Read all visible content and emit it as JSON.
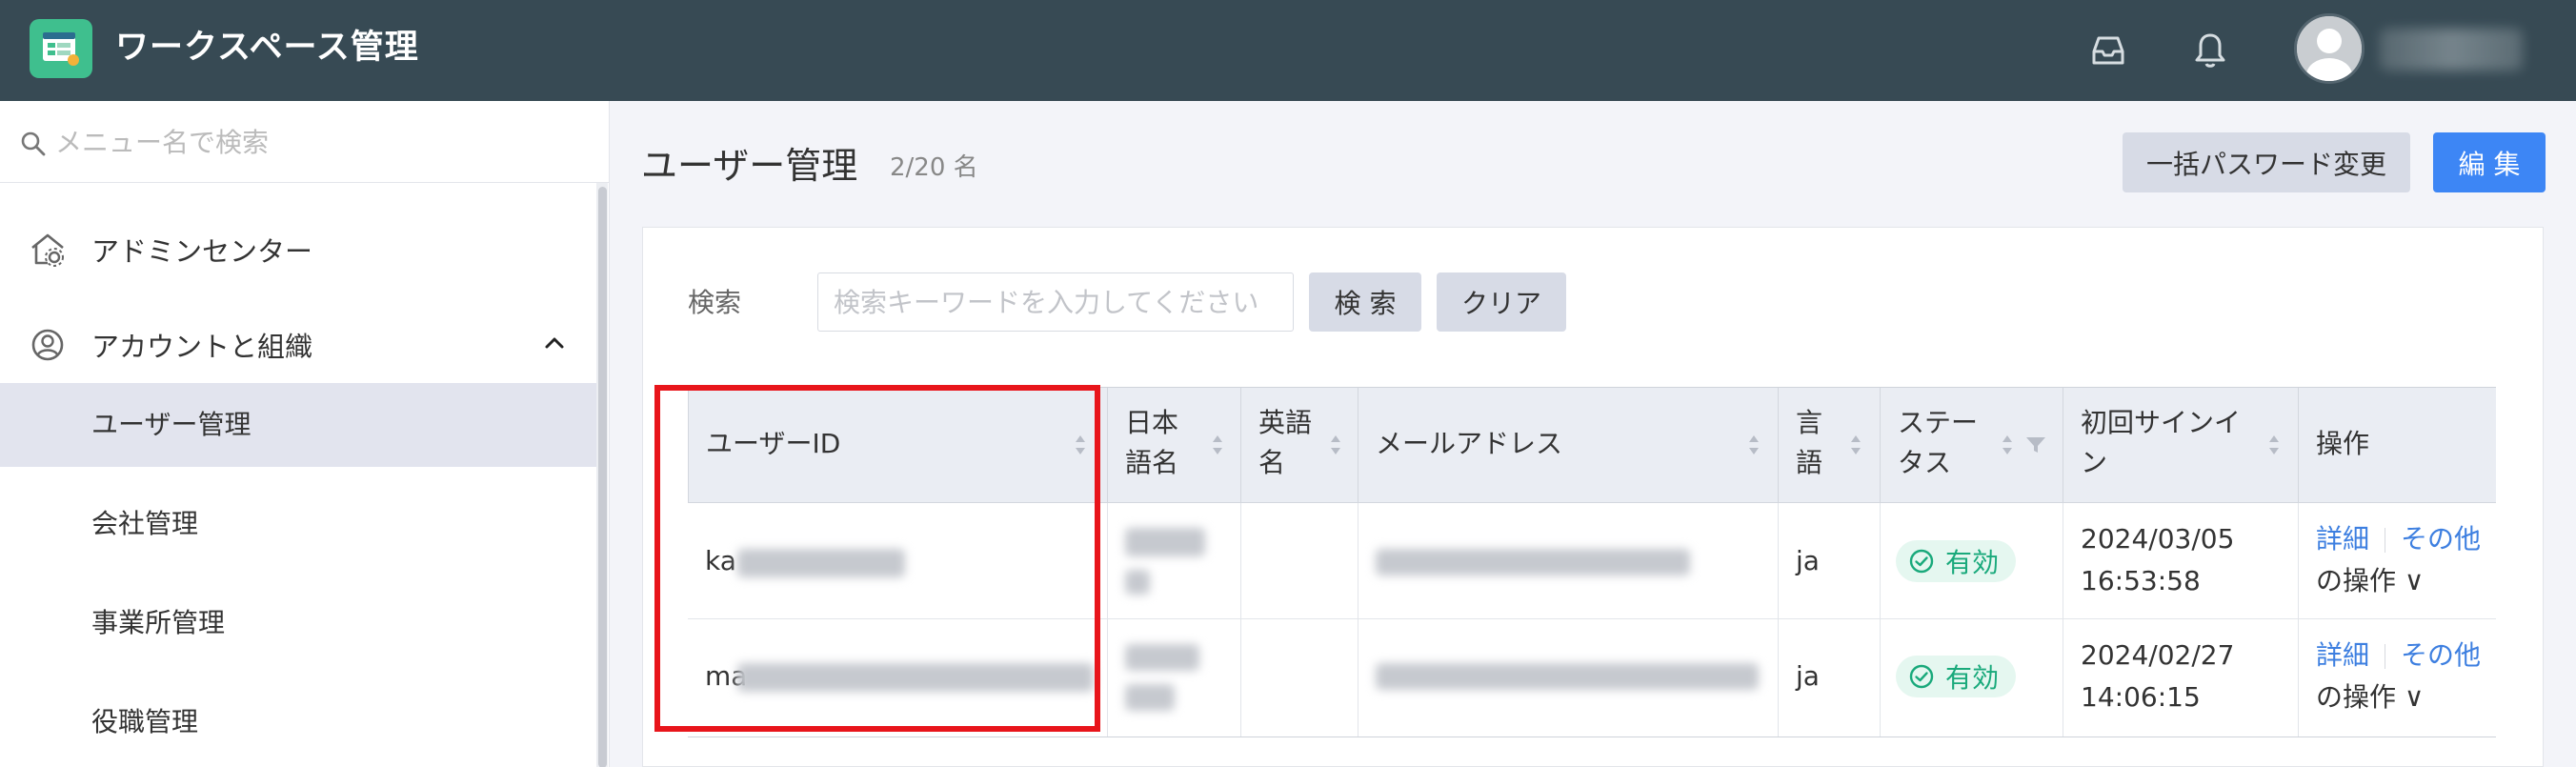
{
  "header": {
    "app_title": "ワークスペース管理",
    "logo_icon": "workspace-logo-icon",
    "inbox_icon": "inbox-icon",
    "bell_icon": "bell-icon",
    "avatar_icon": "user-avatar-icon"
  },
  "sidebar": {
    "search_placeholder": "メニュー名で検索",
    "items": [
      {
        "label": "アドミンセンター",
        "icon": "admin-center-icon"
      },
      {
        "label": "アカウントと組織",
        "icon": "account-icon"
      }
    ],
    "sub_items": [
      {
        "label": "ユーザー管理",
        "active": true
      },
      {
        "label": "会社管理",
        "active": false
      },
      {
        "label": "事業所管理",
        "active": false
      },
      {
        "label": "役職管理",
        "active": false
      }
    ]
  },
  "main": {
    "title": "ユーザー管理",
    "count": "2/20 名",
    "bulk_password_button": "一括パスワード変更",
    "edit_button": "編 集",
    "search_label": "検索",
    "search_placeholder": "検索キーワードを入力してください",
    "search_button": "検 索",
    "clear_button": "クリア"
  },
  "table": {
    "columns": [
      {
        "line1": "ユーザーID",
        "line2": ""
      },
      {
        "line1": "日本",
        "line2": "語名"
      },
      {
        "line1": "英語",
        "line2": "名"
      },
      {
        "line1": "メールアドレス",
        "line2": ""
      },
      {
        "line1": "言",
        "line2": "語"
      },
      {
        "line1": "ステー",
        "line2": "タス"
      },
      {
        "line1": "初回サインイ",
        "line2": "ン"
      },
      {
        "line1": "操作",
        "line2": ""
      }
    ],
    "rows": [
      {
        "user_id_prefix": "ka",
        "language": "ja",
        "status": "有効",
        "first_signin_date": "2024/03/05",
        "first_signin_time": "16:53:58",
        "action_details": "詳細",
        "action_other_1": "その他",
        "action_other_2": "の操作 ∨"
      },
      {
        "user_id_prefix": "ma",
        "language": "ja",
        "status": "有効",
        "first_signin_date": "2024/02/27",
        "first_signin_time": "14:06:15",
        "action_details": "詳細",
        "action_other_1": "その他",
        "action_other_2": "の操作 ∨"
      }
    ]
  },
  "colors": {
    "header_bg": "#374a54",
    "accent_blue": "#3d86f5",
    "status_green": "#19a97b",
    "highlight_red": "#e8151b"
  }
}
